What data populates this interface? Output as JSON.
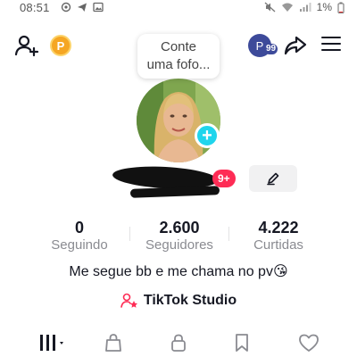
{
  "status_bar": {
    "time": "08:51",
    "battery": "1%"
  },
  "top_bar": {
    "coin_label": "P",
    "mini_avatar_letter": "P",
    "mini_avatar_count": "99"
  },
  "note_bubble": {
    "line1": "Conte",
    "line2": "uma fofo..."
  },
  "profile": {
    "notification_count": "9+",
    "bio": "Me segue bb e me chama no pv😘",
    "studio_label": "TikTok Studio"
  },
  "stats": [
    {
      "value": "0",
      "label": "Seguindo"
    },
    {
      "value": "2.600",
      "label": "Seguidores"
    },
    {
      "value": "4.222",
      "label": "Curtidas"
    }
  ],
  "colors": {
    "accent_red": "#fe2c55",
    "add_blue": "#20d5ec",
    "coin_gold": "#f5a623",
    "muted_text": "#8a8b91"
  },
  "icons": {
    "tabs": [
      "videos-grid-icon",
      "shop-bag-icon",
      "lock-icon",
      "bookmark-icon",
      "heart-icon"
    ]
  }
}
